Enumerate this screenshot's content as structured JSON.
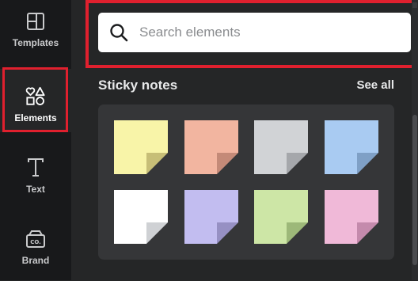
{
  "sidebar": {
    "items": [
      {
        "label": "Templates",
        "icon": "templates-icon"
      },
      {
        "label": "Elements",
        "icon": "elements-icon"
      },
      {
        "label": "Text",
        "icon": "text-icon"
      },
      {
        "label": "Brand",
        "icon": "brand-icon"
      }
    ],
    "active": "Elements"
  },
  "search": {
    "placeholder": "Search elements",
    "value": ""
  },
  "section": {
    "title": "Sticky notes",
    "see_all": "See all"
  },
  "sticky_notes": [
    {
      "color": "#f8f4a8",
      "fold": "#c7be77"
    },
    {
      "color": "#f2b5a0",
      "fold": "#c48a78"
    },
    {
      "color": "#d1d3d6",
      "fold": "#a5a7ab"
    },
    {
      "color": "#a9cbf2",
      "fold": "#7fa0c6"
    },
    {
      "color": "#ffffff",
      "fold": "#cfd1d4"
    },
    {
      "color": "#c2bdf0",
      "fold": "#9690c3"
    },
    {
      "color": "#cde6a6",
      "fold": "#9db879"
    },
    {
      "color": "#f0b9d8",
      "fold": "#c48aac"
    }
  ],
  "colors": {
    "highlight": "#e0202e",
    "sidebar_bg": "#18191b",
    "panel_bg": "#252627"
  }
}
